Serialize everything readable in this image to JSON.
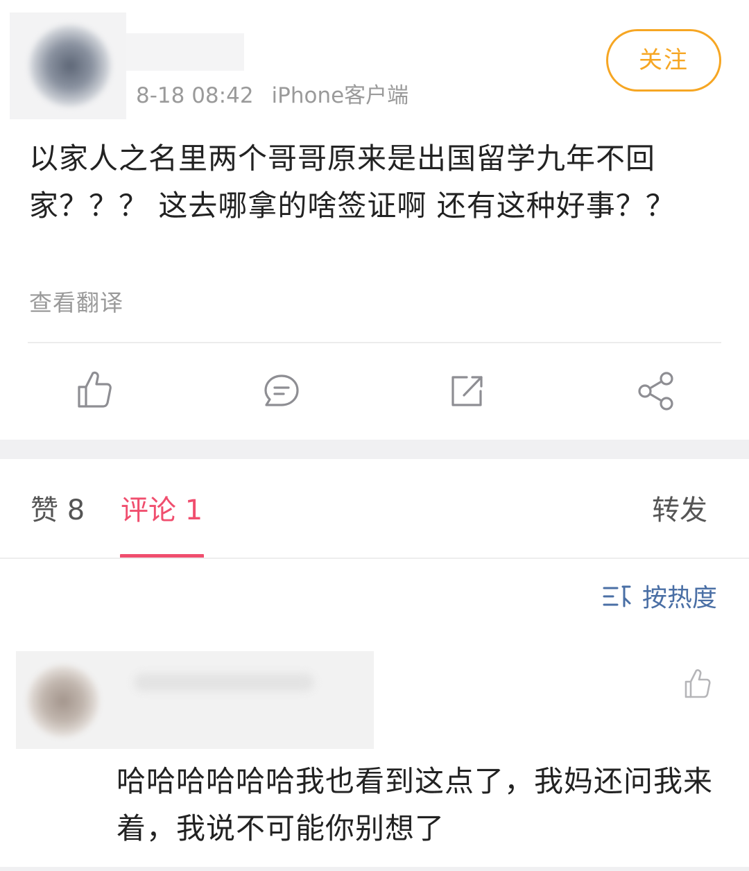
{
  "post": {
    "timestamp": "8-18 08:42",
    "source": "iPhone客户端",
    "follow_label": "关注",
    "text": "以家人之名里两个哥哥原来是出国留学九年不回家？？？ 这去哪拿的啥签证啊 还有这种好事？？",
    "translate_label": "查看翻译"
  },
  "action_bar": {
    "items": [
      {
        "icon": "thumbs-up-icon"
      },
      {
        "icon": "comment-bubble-icon"
      },
      {
        "icon": "repost-icon"
      },
      {
        "icon": "share-icon"
      }
    ]
  },
  "tabs": {
    "likes": "赞 8",
    "comments": "评论 1",
    "reposts": "转发",
    "active": "comments"
  },
  "sort": {
    "label": "按热度",
    "icon": "sort-icon"
  },
  "comments": [
    {
      "text": "哈哈哈哈哈哈我也看到这点了，我妈还问我来着，我说不可能你别想了"
    }
  ],
  "colors": {
    "accent_follow": "#f6a623",
    "active_tab": "#f04e6e",
    "sort_link": "#4a6fa5",
    "secondary_text": "#9a9a9a"
  }
}
